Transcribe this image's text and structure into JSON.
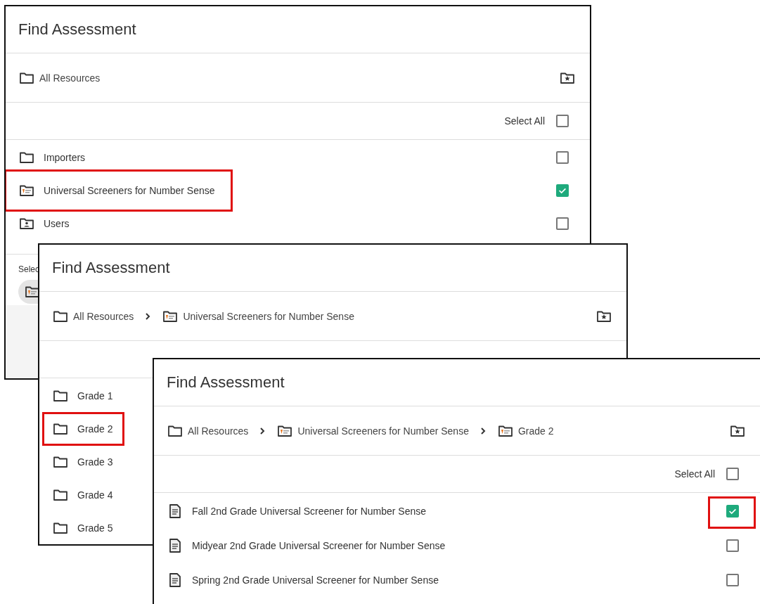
{
  "dialogs": [
    {
      "title": "Find Assessment",
      "breadcrumb": [
        {
          "label": "All Resources",
          "kind": "folder"
        }
      ],
      "select_all": {
        "label": "Select All",
        "checked": false
      },
      "rows": [
        {
          "label": "Importers",
          "kind": "folder",
          "checked": false,
          "highlighted": false
        },
        {
          "label": "Universal Screeners for Number Sense",
          "kind": "logo_folder",
          "checked": true,
          "highlighted": true
        },
        {
          "label": "Users",
          "kind": "user_folder",
          "checked": false,
          "highlighted": false
        }
      ],
      "footer": {
        "label": "Selec",
        "chips": [
          {
            "kind": "logo_folder"
          }
        ]
      }
    },
    {
      "title": "Find Assessment",
      "breadcrumb": [
        {
          "label": "All Resources",
          "kind": "folder"
        },
        {
          "label": "Universal Screeners for Number Sense",
          "kind": "logo_folder"
        }
      ],
      "rows": [
        {
          "label": "Grade 1",
          "kind": "folder",
          "highlighted": false
        },
        {
          "label": "Grade 2",
          "kind": "folder",
          "highlighted": true
        },
        {
          "label": "Grade 3",
          "kind": "folder",
          "highlighted": false
        },
        {
          "label": "Grade 4",
          "kind": "folder",
          "highlighted": false
        },
        {
          "label": "Grade 5",
          "kind": "folder",
          "highlighted": false
        }
      ]
    },
    {
      "title": "Find Assessment",
      "breadcrumb": [
        {
          "label": "All Resources",
          "kind": "folder"
        },
        {
          "label": "Universal Screeners for Number Sense",
          "kind": "logo_folder"
        },
        {
          "label": "Grade 2",
          "kind": "logo_folder"
        }
      ],
      "select_all": {
        "label": "Select All",
        "checked": false
      },
      "rows": [
        {
          "label": "Fall 2nd Grade Universal Screener for Number Sense",
          "kind": "document",
          "checked": true,
          "checkbox_highlighted": true
        },
        {
          "label": "Midyear 2nd Grade Universal Screener for Number Sense",
          "kind": "document",
          "checked": false,
          "checkbox_highlighted": false
        },
        {
          "label": "Spring 2nd Grade Universal Screener for Number Sense",
          "kind": "document",
          "checked": false,
          "checkbox_highlighted": false
        }
      ]
    }
  ]
}
